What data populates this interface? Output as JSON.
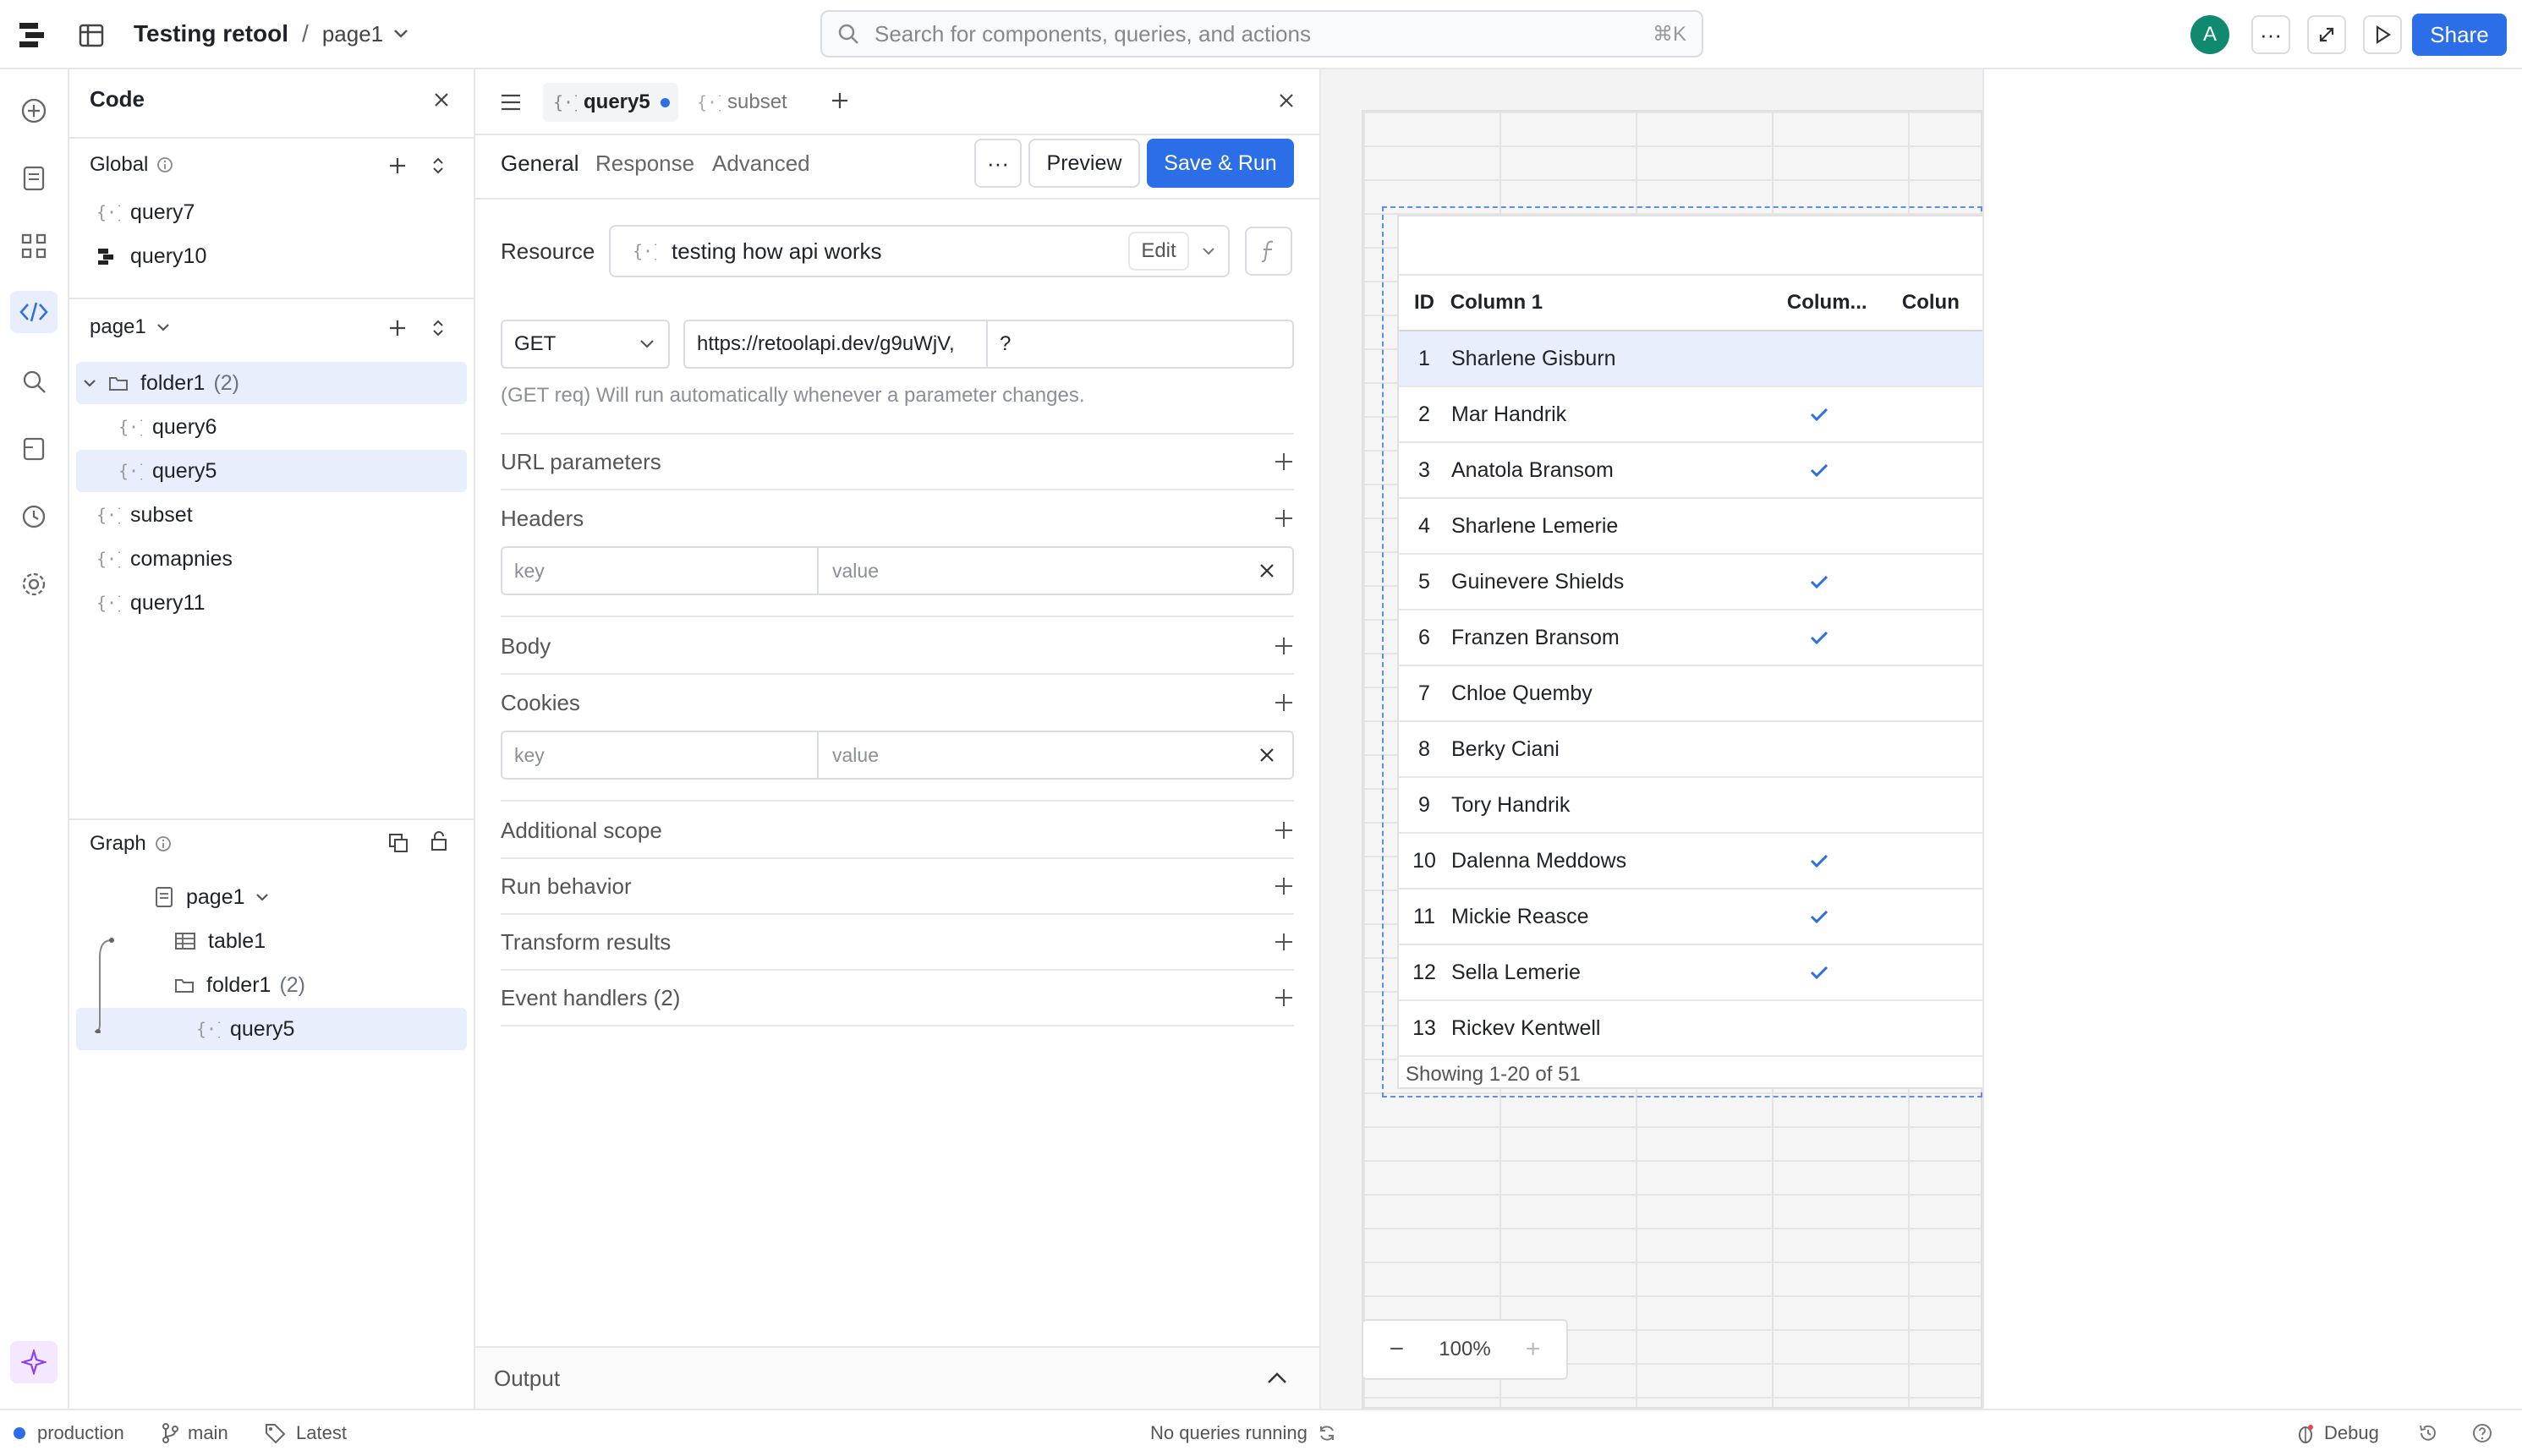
{
  "app": {
    "title": "Testing retool",
    "separator": "/",
    "page": "page1",
    "search_placeholder": "Search for components, queries, and actions",
    "search_shortcut": "⌘K",
    "avatar_letter": "A",
    "share_label": "Share",
    "accent": "#2c6ee8"
  },
  "code_panel": {
    "title": "Code",
    "global_label": "Global",
    "global_items": [
      "query7",
      "query10"
    ],
    "page_label": "page1",
    "folder": {
      "name": "folder1",
      "count": "(2)",
      "items": [
        "query6",
        "query5"
      ]
    },
    "page_items": [
      "subset",
      "comapnies",
      "query11"
    ],
    "graph_label": "Graph",
    "graph": {
      "page": "page1",
      "table": "table1",
      "folder": "folder1",
      "folder_count": "(2)",
      "query": "query5"
    }
  },
  "editor": {
    "tabs": [
      "query5",
      "subset"
    ],
    "subtabs": [
      "General",
      "Response",
      "Advanced"
    ],
    "more": "···",
    "preview_label": "Preview",
    "save_run_label": "Save & Run",
    "resource_label": "Resource",
    "resource_value": "testing how api works",
    "edit_label": "Edit",
    "method": "GET",
    "url": "https://retoolapi.dev/g9uWjV,",
    "url_suffix": "?",
    "hint": "(GET req) Will run automatically whenever a parameter changes.",
    "sections": {
      "url_params": "URL parameters",
      "headers": "Headers",
      "body": "Body",
      "cookies": "Cookies",
      "additional_scope": "Additional scope",
      "run_behavior": "Run behavior",
      "transform_results": "Transform results",
      "event_handlers": "Event handlers (2)"
    },
    "key_placeholder": "key",
    "value_placeholder": "value",
    "output_label": "Output"
  },
  "table": {
    "columns": [
      "ID",
      "Column 1",
      "Colum...",
      "Colun"
    ],
    "rows": [
      {
        "id": "1",
        "name": "Sharlene Gisburn",
        "check": false
      },
      {
        "id": "2",
        "name": "Mar Handrik",
        "check": true
      },
      {
        "id": "3",
        "name": "Anatola Bransom",
        "check": true
      },
      {
        "id": "4",
        "name": "Sharlene Lemerie",
        "check": false
      },
      {
        "id": "5",
        "name": "Guinevere Shields",
        "check": true
      },
      {
        "id": "6",
        "name": "Franzen Bransom",
        "check": true
      },
      {
        "id": "7",
        "name": "Chloe Quemby",
        "check": false
      },
      {
        "id": "8",
        "name": "Berky Ciani",
        "check": false
      },
      {
        "id": "9",
        "name": "Tory Handrik",
        "check": false
      },
      {
        "id": "10",
        "name": "Dalenna Meddows",
        "check": true
      },
      {
        "id": "11",
        "name": "Mickie Reasce",
        "check": true
      },
      {
        "id": "12",
        "name": "Sella Lemerie",
        "check": true
      },
      {
        "id": "13",
        "name": "Rickev Kentwell",
        "check": false
      }
    ],
    "footer": "Showing 1-20 of 51"
  },
  "zoom": {
    "value": "100%",
    "minus": "−",
    "plus": "+"
  },
  "status": {
    "env": "production",
    "branch": "main",
    "tag": "Latest",
    "center": "No queries running",
    "debug": "Debug"
  }
}
